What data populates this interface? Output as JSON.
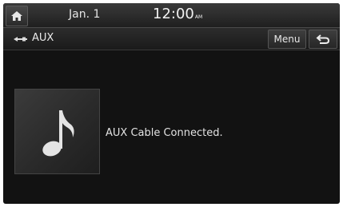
{
  "statusbar": {
    "home_icon": "home-icon",
    "date": "Jan.  1",
    "time": "12:00",
    "ampm": "AM"
  },
  "titlebar": {
    "source_icon": "aux-plug-icon",
    "title": "AUX",
    "menu_label": "Menu",
    "return_icon": "return-arrow-icon"
  },
  "main": {
    "art_icon": "music-note-icon",
    "status_text": "AUX Cable Connected."
  },
  "colors": {
    "background": "#121212",
    "text": "#e6e6e6",
    "bar": "#2a2a2a"
  }
}
